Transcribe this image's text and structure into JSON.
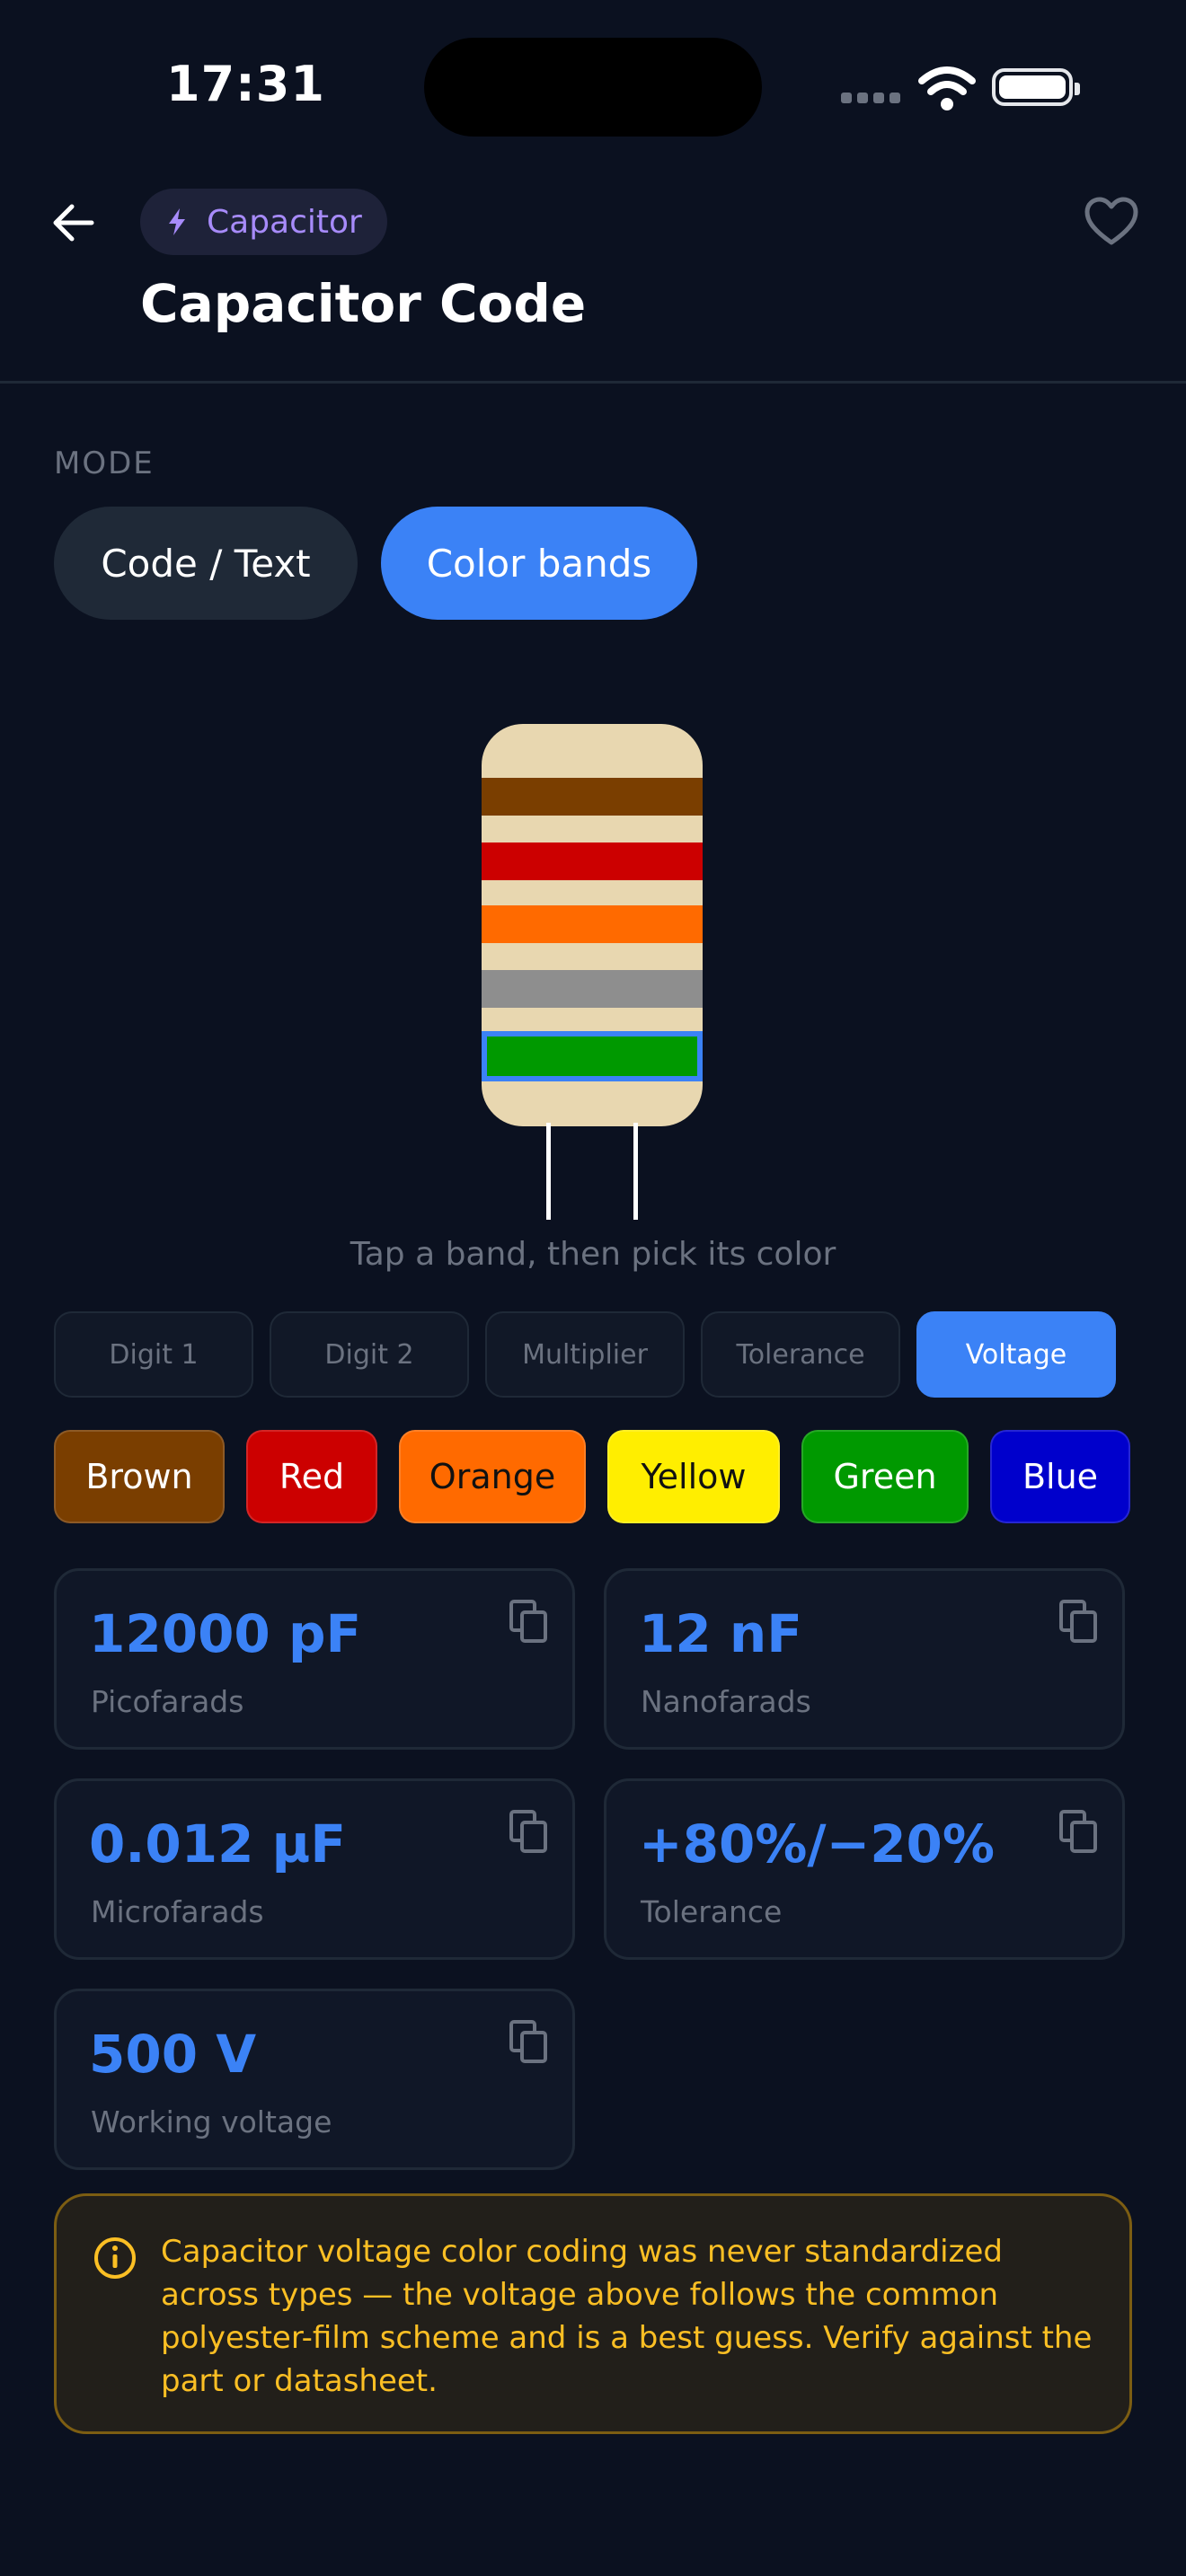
{
  "status_bar": {
    "time": "17:31"
  },
  "header": {
    "category": "Capacitor",
    "title": "Capacitor Code"
  },
  "mode": {
    "label": "MODE",
    "options": [
      "Code / Text",
      "Color bands"
    ],
    "selected": "Color bands"
  },
  "capacitor": {
    "bands": [
      {
        "name": "Digit 1",
        "color": "#7a3e00"
      },
      {
        "name": "Digit 2",
        "color": "#cc0000"
      },
      {
        "name": "Multiplier",
        "color": "#ff6a00"
      },
      {
        "name": "Tolerance",
        "color": "#8e8e8e"
      },
      {
        "name": "Voltage",
        "color": "#009900"
      }
    ],
    "body_color": "#e8d7b0",
    "hint": "Tap a band, then pick its color"
  },
  "band_tabs": {
    "items": [
      "Digit 1",
      "Digit 2",
      "Multiplier",
      "Tolerance",
      "Voltage"
    ],
    "active": "Voltage"
  },
  "colors": {
    "items": [
      {
        "label": "Brown",
        "color": "#7a3e00",
        "text_color": "#ffffff"
      },
      {
        "label": "Red",
        "color": "#cc0000",
        "text_color": "#ffffff"
      },
      {
        "label": "Orange",
        "color": "#ff6a00",
        "text_color": "#111111"
      },
      {
        "label": "Yellow",
        "color": "#ffee00",
        "text_color": "#111111"
      },
      {
        "label": "Green",
        "color": "#009900",
        "text_color": "#ffffff"
      },
      {
        "label": "Blue",
        "color": "#0000cc",
        "text_color": "#ffffff"
      }
    ]
  },
  "results": [
    {
      "value": "12000 pF",
      "label": "Picofarads"
    },
    {
      "value": "12 nF",
      "label": "Nanofarads"
    },
    {
      "value": "0.012 µF",
      "label": "Microfarads"
    },
    {
      "value": "+80%/−20%",
      "label": "Tolerance"
    },
    {
      "value": "500 V",
      "label": "Working voltage"
    }
  ],
  "warning": {
    "text": "Capacitor voltage color coding was never standardized across types — the voltage above follows the common polyester-film scheme and is a best guess. Verify against the part or datasheet."
  },
  "theme": {
    "accent": "#3b82f6",
    "category_accent": "#a78bfa",
    "warning": "#fbbf24"
  }
}
